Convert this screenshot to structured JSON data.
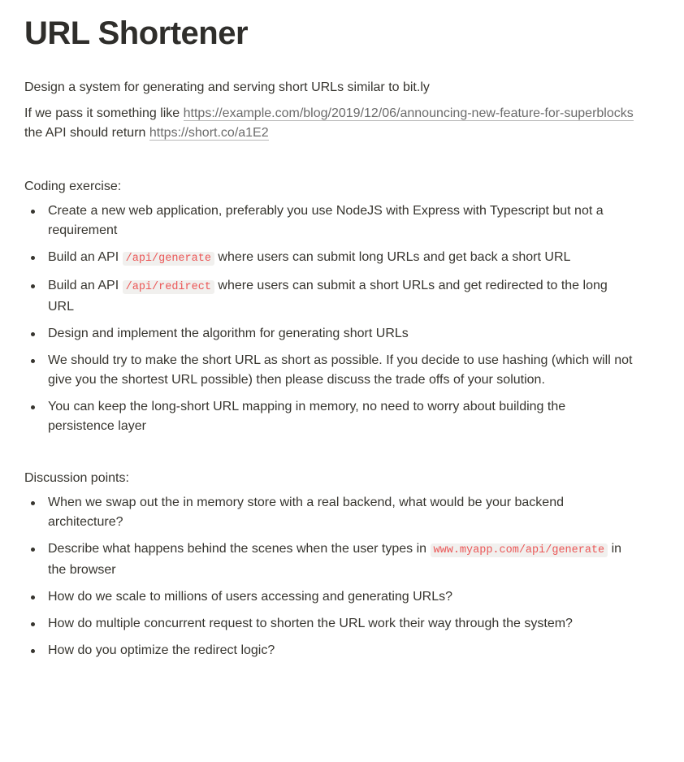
{
  "title": "URL Shortener",
  "intro": {
    "line1": "Design a system for generating and serving short URLs similar to bit.ly",
    "line2_prefix": "If we pass it something like ",
    "long_url": "https://example.com/blog/2019/12/06/announcing-new-feature-for-superblocks",
    "line2_middle": " the API should return ",
    "short_url": "https://short.co/a1E2"
  },
  "coding": {
    "heading": "Coding exercise:",
    "items": {
      "i0": "Create a new web application, preferably you use NodeJS with Express with Typescript but not a requirement",
      "i1_pre": "Build an API ",
      "i1_code": "/api/generate",
      "i1_post": " where users can submit long URLs and get back a short URL",
      "i2_pre": "Build an API ",
      "i2_code": "/api/redirect",
      "i2_post": " where users can submit a short URLs and get redirected to the long URL",
      "i3": "Design and implement the algorithm for generating short URLs",
      "i4": "We should try to make the short URL as short as possible. If you decide to use hashing (which will not give you the shortest URL possible) then please discuss the trade offs of your solution.",
      "i5": "You can keep the long-short URL mapping in memory, no need to worry about building the persistence layer"
    }
  },
  "discussion": {
    "heading": "Discussion points:",
    "items": {
      "d0": "When we swap out the in memory store with a real backend, what would be your backend architecture?",
      "d1_pre": "Describe what happens behind the scenes when the user types in ",
      "d1_code": "www.myapp.com/api/generate",
      "d1_post": " in the browser",
      "d2": "How do we scale to millions of users accessing and generating URLs?",
      "d3": "How do multiple concurrent request to shorten the URL work their way through the system?",
      "d4": "How do you optimize the redirect logic?"
    }
  }
}
